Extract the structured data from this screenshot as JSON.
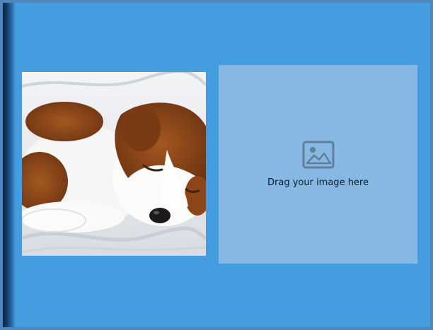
{
  "photo": {
    "subject": "sleeping puppy"
  },
  "drop_zone": {
    "label": "Drag your image here",
    "icon": "image-icon"
  },
  "colors": {
    "background": "#459de0",
    "drop_zone": "#86b8e3",
    "border": "#4f86bb",
    "icon": "#5f7f9a"
  }
}
